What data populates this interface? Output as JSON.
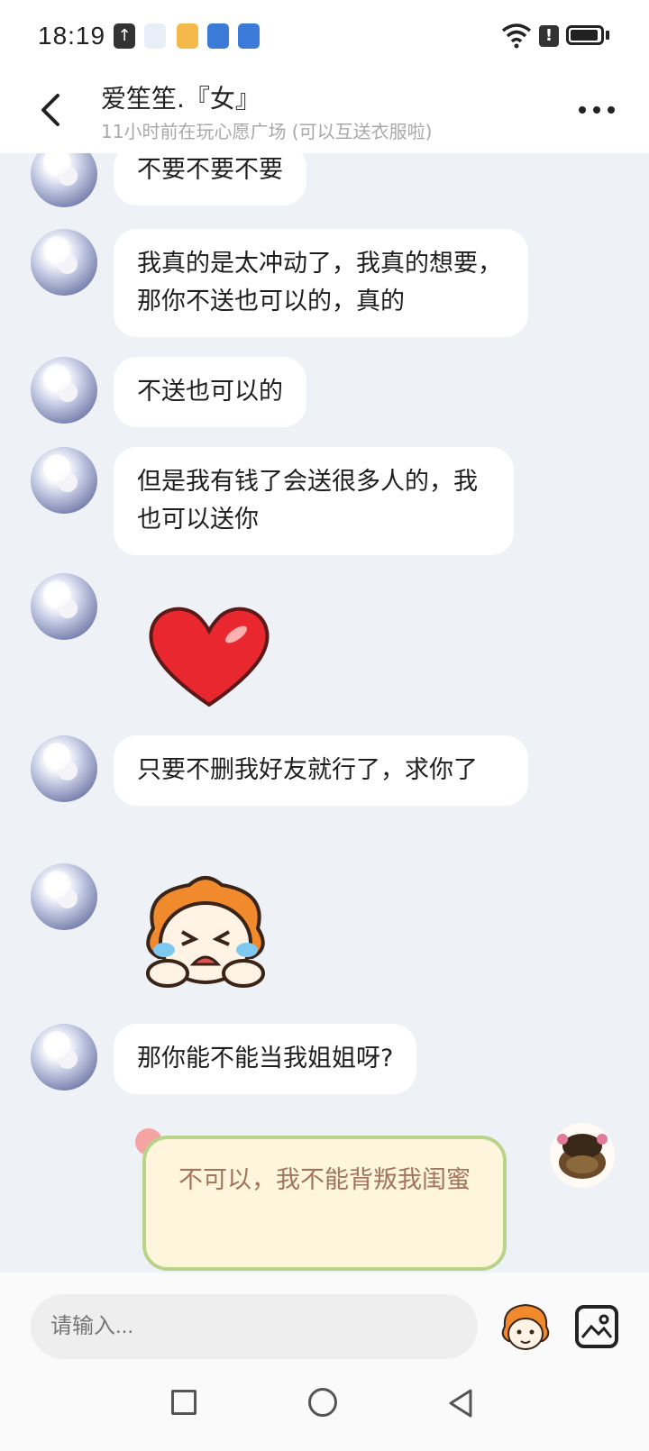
{
  "status_bar": {
    "time": "18:19",
    "icons": [
      "upload-icon",
      "app-icon",
      "weather-icon",
      "app-icon",
      "app-icon",
      "wifi-icon",
      "alert-icon",
      "battery-icon"
    ]
  },
  "header": {
    "title": "爱笙笙.『女』",
    "subtitle": "11小时前在玩心愿广场 (可以互送衣服啦)"
  },
  "messages": [
    {
      "type": "text",
      "text": "不要不要不要"
    },
    {
      "type": "text",
      "text": "我真的是太冲动了，我真的想要，那你不送也可以的，真的"
    },
    {
      "type": "text",
      "text": "不送也可以的"
    },
    {
      "type": "text",
      "text": "但是我有钱了会送很多人的，我也可以送你"
    },
    {
      "type": "sticker",
      "name": "heart-sticker"
    },
    {
      "type": "text",
      "text": "只要不删我好友就行了，求你了"
    },
    {
      "type": "sticker",
      "name": "crying-face-sticker"
    },
    {
      "type": "text",
      "text": "那你能不能当我姐姐呀?"
    }
  ],
  "my_message": {
    "text": "不可以，我不能背叛我闺蜜"
  },
  "input": {
    "placeholder": "请输入..."
  },
  "colors": {
    "chat_background": "#eef2f7",
    "bubble": "#ffffff",
    "my_bubble": "#fdf6dc",
    "my_bubble_border": "#b9d48a",
    "my_text": "#a3735c"
  }
}
